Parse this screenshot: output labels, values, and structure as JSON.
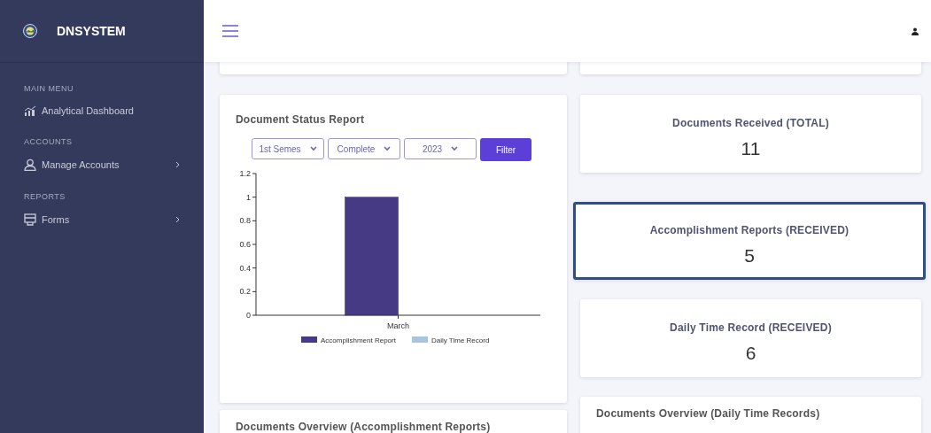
{
  "sidebar": {
    "brand": "DNSYSTEM",
    "sections": [
      {
        "heading": "MAIN MENU",
        "items": [
          {
            "label": "Analytical Dashboard",
            "has_submenu": false
          }
        ]
      },
      {
        "heading": "ACCOUNTS",
        "items": [
          {
            "label": "Manage Accounts",
            "has_submenu": true
          }
        ]
      },
      {
        "heading": "REPORTS",
        "items": [
          {
            "label": "Forms",
            "has_submenu": true
          }
        ]
      }
    ]
  },
  "status_report": {
    "title": "Document Status Report",
    "filters": [
      {
        "value": "1st Semes"
      },
      {
        "value": "Complete"
      },
      {
        "value": "2023"
      }
    ],
    "filter_button": "Filter",
    "chart_data": {
      "type": "bar",
      "categories": [
        "March"
      ],
      "series": [
        {
          "name": "Accomplishment Report",
          "color": "#463a85",
          "values": [
            1
          ]
        },
        {
          "name": "Daily Time Record",
          "color": "#a9c4de",
          "values": [
            0
          ]
        }
      ],
      "ylim": [
        0,
        1.2
      ],
      "yticks": [
        0,
        0.2,
        0.4,
        0.6,
        0.8,
        1,
        {
          "value": 1.2,
          "label": "1.2"
        }
      ]
    }
  },
  "stats": [
    {
      "title": "Documents Received (TOTAL)",
      "count": "11",
      "selected": false
    },
    {
      "title": "Accomplishment Reports (RECEIVED)",
      "count": "5",
      "selected": true
    },
    {
      "title": "Daily Time Record (RECEIVED)",
      "count": "6",
      "selected": false
    }
  ],
  "overviews": [
    {
      "title": "Documents Overview (Accomplishment Reports)"
    },
    {
      "title": "Documents Overview (Daily Time Records)"
    }
  ]
}
